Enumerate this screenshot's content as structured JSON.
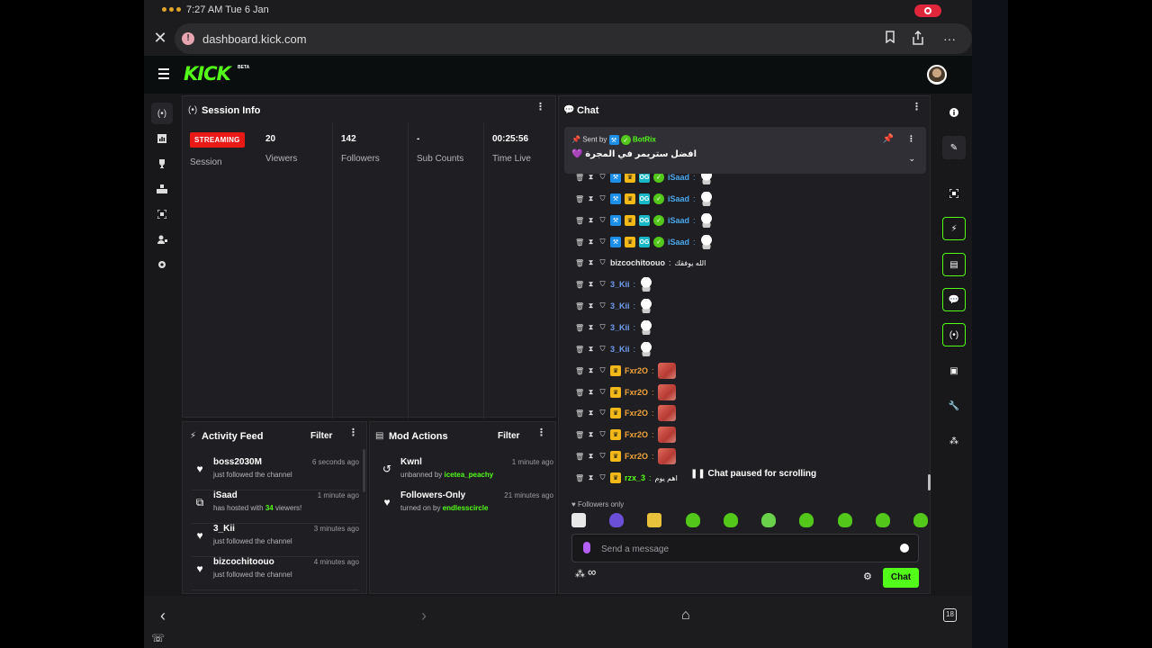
{
  "status_bar": {
    "time": "7:27 AM  Tue 6 Jan"
  },
  "browser": {
    "url": "dashboard.kick.com",
    "tab_count": "18"
  },
  "header": {
    "logo": "KICK",
    "beta": "BETA"
  },
  "session_info": {
    "title": "Session Info",
    "streaming_badge": "STREAMING",
    "session_label": "Session",
    "stats": [
      {
        "value": "20",
        "label": "Viewers"
      },
      {
        "value": "142",
        "label": "Followers"
      },
      {
        "value": "-",
        "label": "Sub Counts"
      },
      {
        "value": "00:25:56",
        "label": "Time Live"
      }
    ]
  },
  "activity_feed": {
    "title": "Activity Feed",
    "filter": "Filter",
    "items": [
      {
        "icon": "heart-icon",
        "name": "boss2030M",
        "time": "6 seconds ago",
        "text": "just followed the channel"
      },
      {
        "icon": "host-icon",
        "name": "iSaad",
        "time": "1 minute ago",
        "text_pre": "has hosted with ",
        "text_num": "34",
        "text_post": " viewers!"
      },
      {
        "icon": "heart-icon",
        "name": "3_Kii",
        "time": "3 minutes ago",
        "text": "just followed the channel"
      },
      {
        "icon": "heart-icon",
        "name": "bizcochitoouo",
        "time": "4 minutes ago",
        "text": "just followed the channel"
      }
    ]
  },
  "mod_actions": {
    "title": "Mod Actions",
    "filter": "Filter",
    "items": [
      {
        "icon": "unban-icon",
        "name": "Kwnl",
        "time": "1 minute ago",
        "text": "unbanned by ",
        "by": "icetea_peachy"
      },
      {
        "icon": "heart-icon",
        "name": "Followers-Only",
        "time": "21 minutes ago",
        "text": "turned on by ",
        "by": "endlesscircle"
      }
    ]
  },
  "chat": {
    "title": "Chat",
    "pinned": {
      "sent_by": "Sent by",
      "user": "BotRix",
      "message": "افضل ستريمر في المجرة 💜"
    },
    "messages": [
      {
        "user": "iSaad",
        "color": "#4aa8f0",
        "badges": [
          "blue",
          "gold",
          "teal",
          "green"
        ],
        "emote": "ghost",
        "text": ""
      },
      {
        "user": "iSaad",
        "color": "#4aa8f0",
        "badges": [
          "blue",
          "gold",
          "teal",
          "green"
        ],
        "emote": "ghost",
        "text": ""
      },
      {
        "user": "iSaad",
        "color": "#4aa8f0",
        "badges": [
          "blue",
          "gold",
          "teal",
          "green"
        ],
        "emote": "ghost",
        "text": ""
      },
      {
        "user": "iSaad",
        "color": "#4aa8f0",
        "badges": [
          "blue",
          "gold",
          "teal",
          "green"
        ],
        "emote": "ghost",
        "text": ""
      },
      {
        "user": "bizcochitoouo",
        "color": "#e8e8e8",
        "badges": [],
        "emote": "",
        "text": "الله يوفقك"
      },
      {
        "user": "3_Kii",
        "color": "#6f9df2",
        "badges": [],
        "emote": "ghost",
        "text": ""
      },
      {
        "user": "3_Kii",
        "color": "#6f9df2",
        "badges": [],
        "emote": "ghost",
        "text": ""
      },
      {
        "user": "3_Kii",
        "color": "#6f9df2",
        "badges": [],
        "emote": "ghost",
        "text": ""
      },
      {
        "user": "3_Kii",
        "color": "#6f9df2",
        "badges": [],
        "emote": "ghost",
        "text": ""
      },
      {
        "user": "Fxr2O",
        "color": "#f2a33a",
        "badges": [
          "gold"
        ],
        "emote": "face",
        "text": ""
      },
      {
        "user": "Fxr2O",
        "color": "#f2a33a",
        "badges": [
          "gold"
        ],
        "emote": "face",
        "text": ""
      },
      {
        "user": "Fxr2O",
        "color": "#f2a33a",
        "badges": [
          "gold"
        ],
        "emote": "face",
        "text": ""
      },
      {
        "user": "Fxr2O",
        "color": "#f2a33a",
        "badges": [
          "gold"
        ],
        "emote": "face",
        "text": ""
      },
      {
        "user": "Fxr2O",
        "color": "#f2a33a",
        "badges": [
          "gold"
        ],
        "emote": "face",
        "text": ""
      },
      {
        "user": "rzx_3",
        "color": "#53fc18",
        "badges": [
          "gold"
        ],
        "emote": "",
        "text": "اهم يوم"
      }
    ],
    "paused_text": "Chat paused for scrolling",
    "followers_only": "Followers only",
    "emote_colors": [
      "#e8e8e8",
      "#6c4fd8",
      "#e8c23a",
      "#53c81a",
      "#53c81a",
      "#6ad14a",
      "#53c81a",
      "#53c81a",
      "#53c81a",
      "#53c81a"
    ],
    "input_placeholder": "Send a message",
    "chat_button": "Chat",
    "infinity": "∞"
  }
}
